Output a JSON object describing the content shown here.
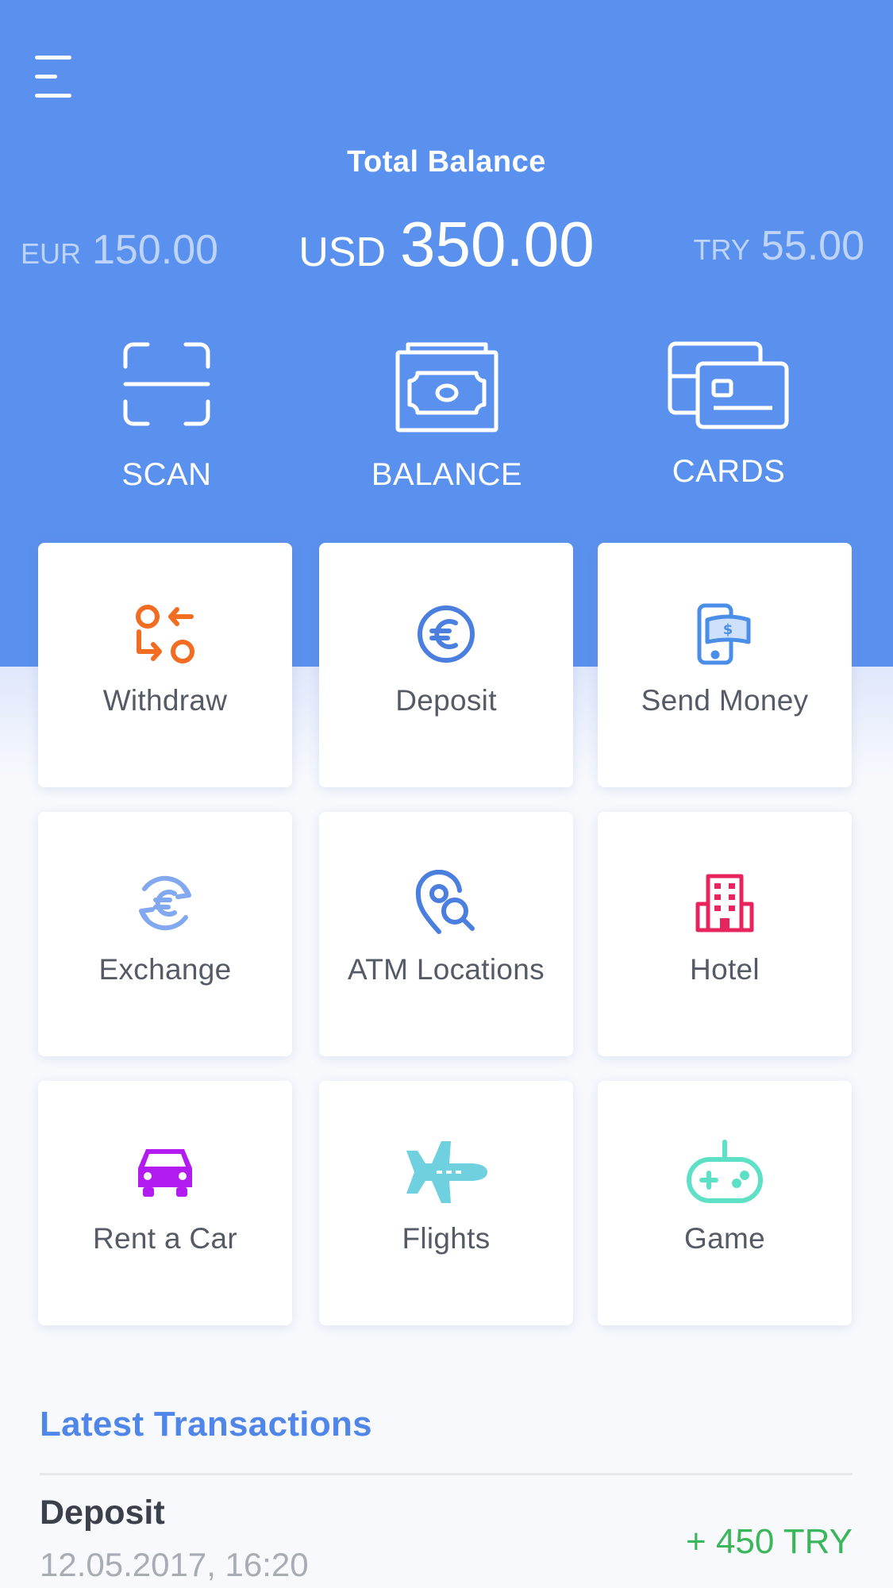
{
  "header": {
    "title": "Total Balance",
    "balances": {
      "eur": {
        "code": "EUR",
        "amount": "150.00"
      },
      "usd": {
        "code": "USD",
        "amount": "350.00"
      },
      "try": {
        "code": "TRY",
        "amount": "55.00"
      }
    }
  },
  "quick_actions": [
    {
      "label": "SCAN",
      "icon": "scan-icon"
    },
    {
      "label": "BALANCE",
      "icon": "banknote-icon"
    },
    {
      "label": "CARDS",
      "icon": "cards-icon"
    }
  ],
  "services": [
    {
      "label": "Withdraw",
      "icon": "withdraw-icon",
      "color": "#f26d21"
    },
    {
      "label": "Deposit",
      "icon": "euro-coin-icon",
      "color": "#4a7fe0"
    },
    {
      "label": "Send Money",
      "icon": "send-money-phone-icon",
      "color": "#4a8ee8"
    },
    {
      "label": "Exchange",
      "icon": "exchange-icon",
      "color": "#82a8ef"
    },
    {
      "label": "ATM Locations",
      "icon": "atm-location-icon",
      "color": "#4a7fe0"
    },
    {
      "label": "Hotel",
      "icon": "hotel-icon",
      "color": "#e8245f"
    },
    {
      "label": "Rent a Car",
      "icon": "car-icon",
      "color": "#b31cf0"
    },
    {
      "label": "Flights",
      "icon": "airplane-icon",
      "color": "#6fd0e0"
    },
    {
      "label": "Game",
      "icon": "gamepad-icon",
      "color": "#5ee0c6"
    }
  ],
  "transactions": {
    "title": "Latest Transactions",
    "items": [
      {
        "name": "Deposit",
        "date": "12.05.2017, 16:20",
        "amount": "+ 450 TRY",
        "amount_color": "#3cb65a"
      }
    ]
  },
  "colors": {
    "primary": "#5b91ee",
    "accent_text": "#4f86e8",
    "background": "#f7f9fd"
  }
}
